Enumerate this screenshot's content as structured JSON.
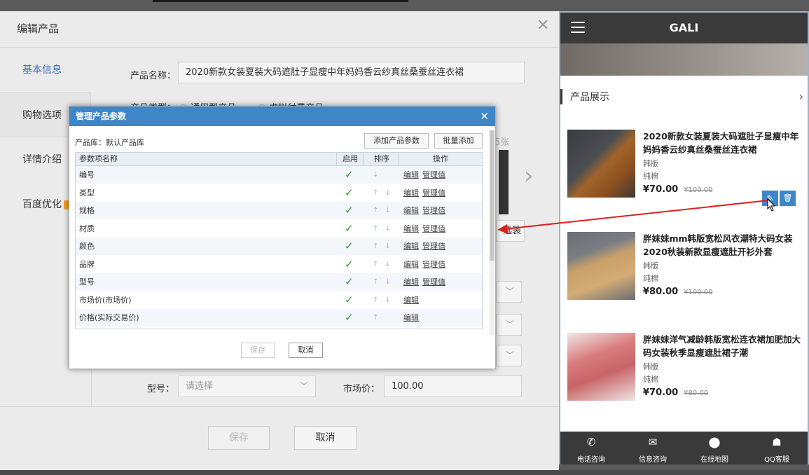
{
  "edit_panel": {
    "title": "编辑产品",
    "nav": [
      "基本信息",
      "购物选项",
      "详情介绍",
      "百度优化"
    ],
    "product_name_label": "产品名称：",
    "product_name_value": "2020新款女装夏装大码遮肚子显瘦中年妈妈香云纱真丝桑蚕丝连衣裙",
    "product_type_label": "产品类型：",
    "type_options": [
      "通用型产品",
      "虚拟付费产品"
    ],
    "image_count": "5张",
    "side_button": "选装",
    "model_label": "型号：",
    "model_placeholder": "请选择",
    "market_price_label": "市场价：",
    "market_price_value": "100.00",
    "save": "保存",
    "cancel": "取消"
  },
  "dialog": {
    "title": "管理产品参数",
    "library_label": "产品库：默认产品库",
    "add_param_button": "添加产品参数",
    "batch_add_button": "批量添加",
    "columns": [
      "参数项名称",
      "启用",
      "排序",
      "操作"
    ],
    "rows": [
      {
        "name": "编号",
        "enabled": "✓",
        "sort": "↓",
        "ops": [
          "编辑",
          "管理值"
        ]
      },
      {
        "name": "类型",
        "enabled": "✓",
        "sort": "↑ ↓",
        "ops": [
          "编辑",
          "管理值"
        ]
      },
      {
        "name": "规格",
        "enabled": "✓",
        "sort": "↑ ↓",
        "ops": [
          "编辑",
          "管理值"
        ]
      },
      {
        "name": "材质",
        "enabled": "✓",
        "sort": "↑ ↓",
        "ops": [
          "编辑",
          "管理值"
        ]
      },
      {
        "name": "颜色",
        "enabled": "✓",
        "sort": "↑ ↓",
        "ops": [
          "编辑",
          "管理值"
        ]
      },
      {
        "name": "品牌",
        "enabled": "✓",
        "sort": "↑ ↓",
        "ops": [
          "编辑",
          "管理值"
        ]
      },
      {
        "name": "型号",
        "enabled": "✓",
        "sort": "↑ ↓",
        "ops": [
          "编辑",
          "管理值"
        ]
      },
      {
        "name": "市场价(市场价)",
        "enabled": "✓",
        "sort": "↑ ↓",
        "ops": [
          "编辑"
        ]
      },
      {
        "name": "价格(实际交易价)",
        "enabled": "✓",
        "sort": "↑",
        "ops": [
          "编辑"
        ]
      }
    ],
    "save": "保存",
    "cancel": "取消",
    "accent": "#3f86c8",
    "check_color": "#2c9a2c"
  },
  "phone": {
    "brand": "GALI",
    "section_title": "产品展示",
    "products": [
      {
        "name": "2020新款女装夏装大码遮肚子显瘦中年妈妈香云纱真丝桑蚕丝连衣裙",
        "tag1": "韩版",
        "tag2": "纯棉",
        "price": "¥70.00",
        "old_price": "¥100.00"
      },
      {
        "name": "胖妹妹mm韩版宽松风衣潮特大码女装2020秋装新款显瘦遮肚开衫外套",
        "tag1": "韩版",
        "tag2": "纯棉",
        "price": "¥80.00",
        "old_price": "¥100.00"
      },
      {
        "name": "胖妹妹洋气减龄韩版宽松连衣裙加肥加大码女装秋季显瘦遮肚裙子潮",
        "tag1": "韩版",
        "tag2": "纯棉",
        "price": "¥70.00",
        "old_price": "¥80.00"
      }
    ],
    "footer": [
      {
        "label": "电话咨询",
        "icon": "phone-icon"
      },
      {
        "label": "信息咨询",
        "icon": "mail-icon"
      },
      {
        "label": "在线地图",
        "icon": "map-pin-icon"
      },
      {
        "label": "QQ客服",
        "icon": "qq-icon"
      }
    ]
  }
}
